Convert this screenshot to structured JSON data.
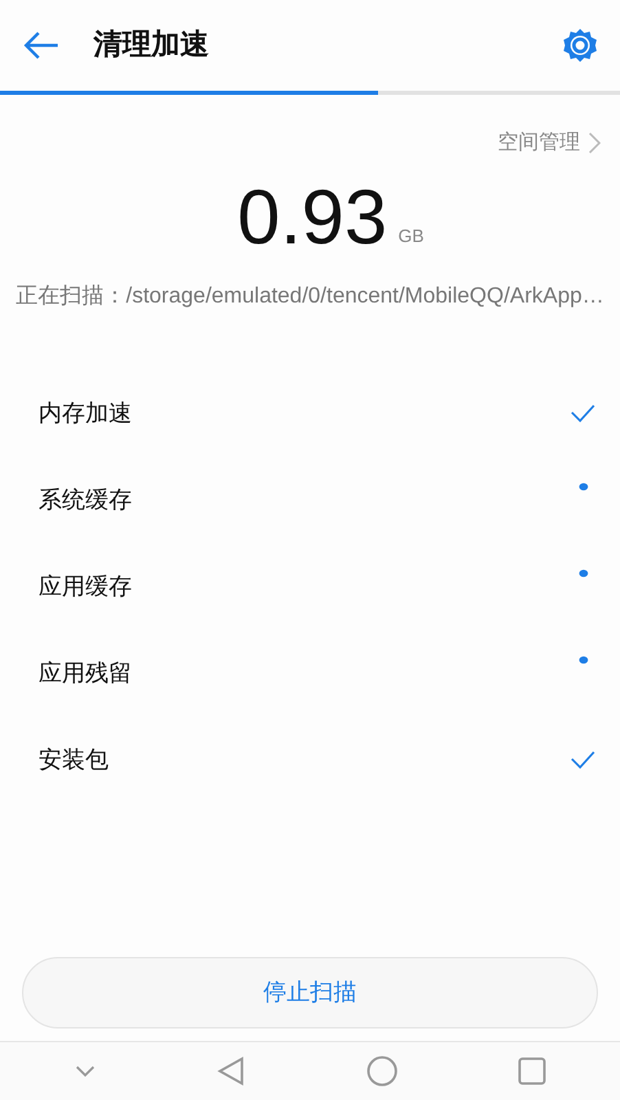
{
  "header": {
    "title": "清理加速"
  },
  "progress": {
    "level": 0.61
  },
  "space_link": {
    "label": "空间管理"
  },
  "size": {
    "value": "0.93",
    "unit": "GB"
  },
  "scan": {
    "label": "正在扫描：",
    "path": "/storage/emulated/0/tencent/MobileQQ/ArkApp…"
  },
  "items": [
    {
      "label": "内存加速",
      "kind": "done"
    },
    {
      "label": "系统缓存",
      "kind": "scanning"
    },
    {
      "label": "应用缓存",
      "kind": "scanning"
    },
    {
      "label": "应用残留",
      "kind": "scanning"
    },
    {
      "label": "安装包",
      "kind": "done"
    }
  ],
  "stop_button": {
    "label": "停止扫描"
  }
}
